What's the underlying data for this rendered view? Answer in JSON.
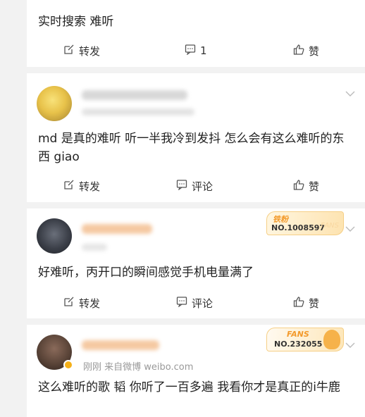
{
  "posts": [
    {
      "text": "实时搜索 难听",
      "actions": {
        "repost": "转发",
        "comment": "1",
        "like": "赞"
      }
    },
    {
      "text": "md 是真的难听 听一半我冷到发抖 怎么会有这么难听的东西 giao",
      "actions": {
        "repost": "转发",
        "comment": "评论",
        "like": "赞"
      }
    },
    {
      "badge": {
        "tag": "铁粉",
        "number": "NO.1008597",
        "watermark": "FANS"
      },
      "text": "好难听，丙开口的瞬间感觉手机电量满了",
      "actions": {
        "repost": "转发",
        "comment": "评论",
        "like": "赞"
      }
    },
    {
      "badge": {
        "tag": "FANS",
        "number": "NO.232055"
      },
      "source": "刚刚 来自微博 weibo.com",
      "text": "这么难听的歌 韬 你听了一百多遍 我看你才是真正的i牛鹿"
    }
  ],
  "colors": {
    "accent_orange": "#f39a2b",
    "text": "#222222",
    "muted": "#999999"
  },
  "icons": {
    "repost": "edit-square-icon",
    "comment": "comment-icon",
    "like": "thumbs-up-icon",
    "chevron": "chevron-down-icon"
  }
}
